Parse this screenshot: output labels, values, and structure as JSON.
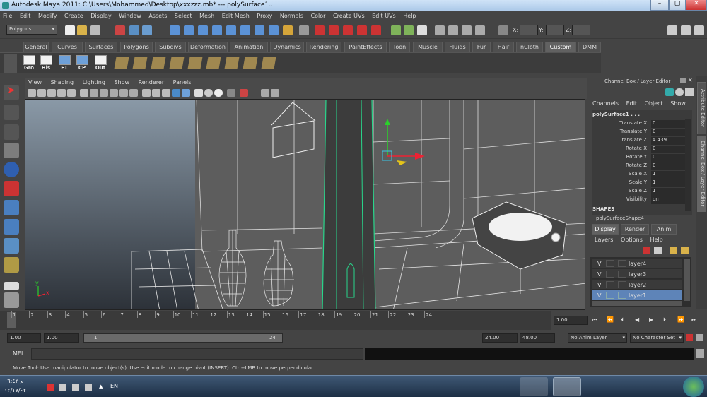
{
  "title": {
    "text": "Autodesk Maya 2011: C:\\Users\\Mohammed\\Desktop\\xxxzzz.mb*   ---   polySurface1..."
  },
  "menu": [
    "File",
    "Edit",
    "Modify",
    "Create",
    "Display",
    "Window",
    "Assets",
    "Select",
    "Mesh",
    "Edit Mesh",
    "Proxy",
    "Normals",
    "Color",
    "Create UVs",
    "Edit UVs",
    "Help"
  ],
  "status": {
    "mode": "Polygons",
    "x_label": "X:",
    "y_label": "Y:",
    "z_label": "Z:"
  },
  "shelf_tabs": [
    "General",
    "Curves",
    "Surfaces",
    "Polygons",
    "Subdivs",
    "Deformation",
    "Animation",
    "Dynamics",
    "Rendering",
    "PaintEffects",
    "Toon",
    "Muscle",
    "Fluids",
    "Fur",
    "Hair",
    "nCloth",
    "Custom",
    "DMM"
  ],
  "shelf_tab_active": "Custom",
  "shelf_buttons": [
    "Gro",
    "His",
    "FT",
    "CP",
    "Out"
  ],
  "viewport_menu": [
    "View",
    "Shading",
    "Lighting",
    "Show",
    "Renderer",
    "Panels"
  ],
  "channel_box": {
    "title": "Channel Box / Layer Editor",
    "menu": [
      "Channels",
      "Edit",
      "Object",
      "Show"
    ],
    "object": "polySurface1 . . .",
    "attrs": [
      {
        "name": "Translate X",
        "value": "0"
      },
      {
        "name": "Translate Y",
        "value": "0"
      },
      {
        "name": "Translate Z",
        "value": "4.439"
      },
      {
        "name": "Rotate X",
        "value": "0"
      },
      {
        "name": "Rotate Y",
        "value": "0"
      },
      {
        "name": "Rotate Z",
        "value": "0"
      },
      {
        "name": "Scale X",
        "value": "1"
      },
      {
        "name": "Scale Y",
        "value": "1"
      },
      {
        "name": "Scale Z",
        "value": "1"
      },
      {
        "name": "Visibility",
        "value": "on"
      }
    ],
    "shapes_label": "SHAPES",
    "shape_name": "polySurfaceShape4"
  },
  "layer_editor": {
    "tabs": [
      "Display",
      "Render",
      "Anim"
    ],
    "active_tab": "Display",
    "menu": [
      "Layers",
      "Options",
      "Help"
    ],
    "layers": [
      {
        "v": "V",
        "name": "layer4"
      },
      {
        "v": "V",
        "name": "layer3"
      },
      {
        "v": "V",
        "name": "layer2"
      },
      {
        "v": "V",
        "name": "layer1"
      }
    ],
    "selected": "layer1"
  },
  "side_tabs": [
    "Attribute Editor",
    "Channel Box / Layer Editor"
  ],
  "timeline": {
    "ticks": [
      "1",
      "2",
      "3",
      "4",
      "5",
      "6",
      "7",
      "8",
      "9",
      "10",
      "11",
      "12",
      "13",
      "14",
      "15",
      "16",
      "17",
      "18",
      "19",
      "20",
      "21",
      "22",
      "23",
      "24"
    ],
    "current_frame": "1.00"
  },
  "range": {
    "start": "1.00",
    "current": "1.00",
    "range_start": "1",
    "range_end": "24",
    "end": "24.00",
    "total": "48.00",
    "anim_layer": "No Anim Layer",
    "char_set": "No Character Set"
  },
  "mel": {
    "label": "MEL"
  },
  "help_line": "Move Tool: Use manipulator to move object(s). Use edit mode to change pivot (INSERT).  Ctrl+LMB to move perpendicular.",
  "taskbar": {
    "clock_time": "م ٠٦:٤٢",
    "clock_date": "١٢/١٧/٠٢",
    "lang": "EN"
  },
  "axis": {
    "y": "y",
    "x": "x"
  }
}
